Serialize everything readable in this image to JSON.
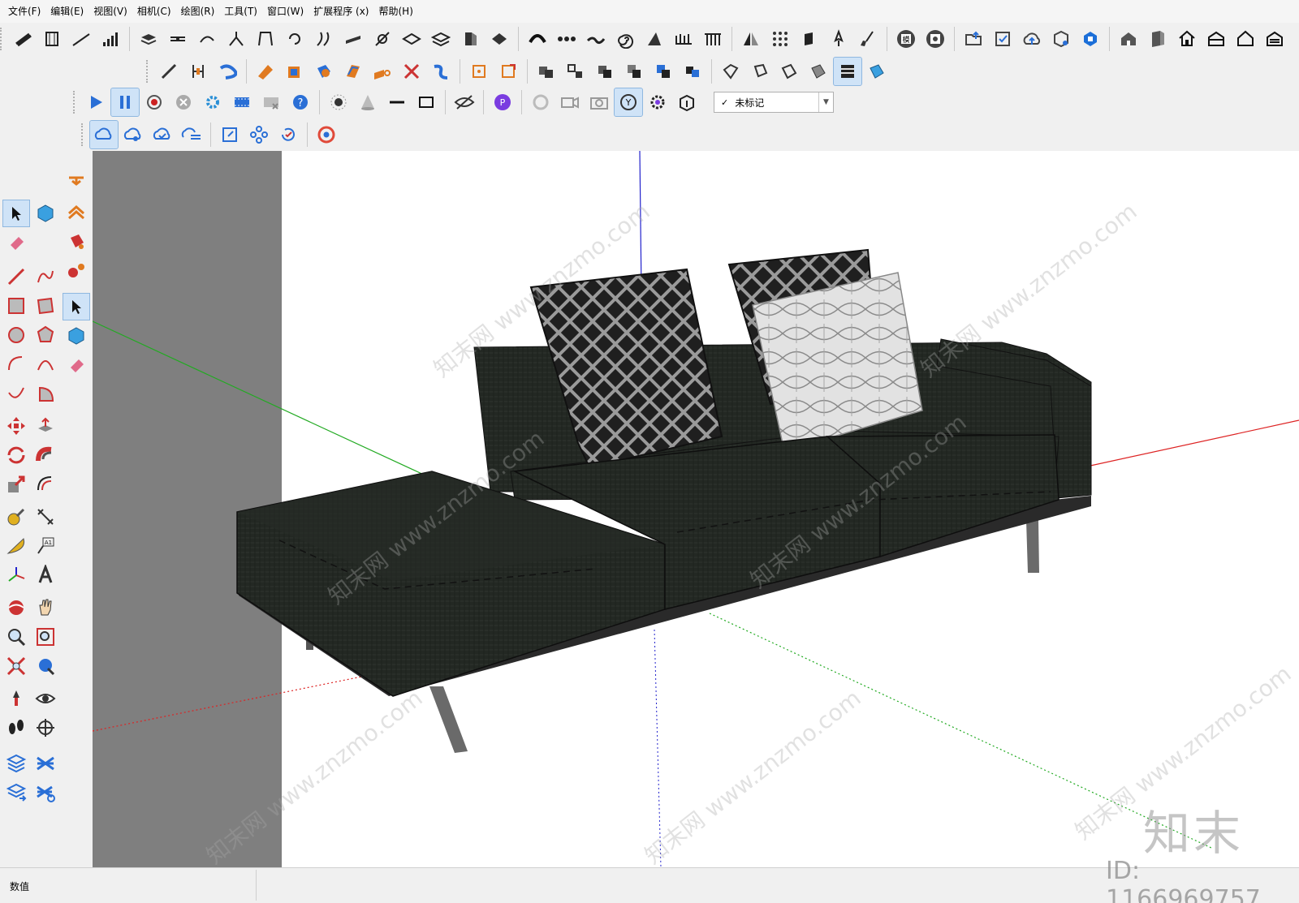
{
  "menu": [
    {
      "label": "文件(F)"
    },
    {
      "label": "编辑(E)"
    },
    {
      "label": "视图(V)"
    },
    {
      "label": "相机(C)"
    },
    {
      "label": "绘图(R)"
    },
    {
      "label": "工具(T)"
    },
    {
      "label": "窗口(W)"
    },
    {
      "label": "扩展程序 (x)"
    },
    {
      "label": "帮助(H)"
    }
  ],
  "tag_dropdown": {
    "checkmark": "✓",
    "selected": "未标记"
  },
  "status": {
    "measurements_label": "数值"
  },
  "watermark": {
    "site": "知末网 www.znzmo.com",
    "logo": "知末",
    "id": "ID: 1166969757"
  },
  "colors": {
    "axis_red": "#d22",
    "axis_green": "#2a2",
    "axis_blue": "#22c",
    "sofa_fabric": "#232823",
    "pillow_dark": "#262626",
    "pillow_light": "#dcdcdc",
    "accent_blue": "#2a6fd6"
  }
}
